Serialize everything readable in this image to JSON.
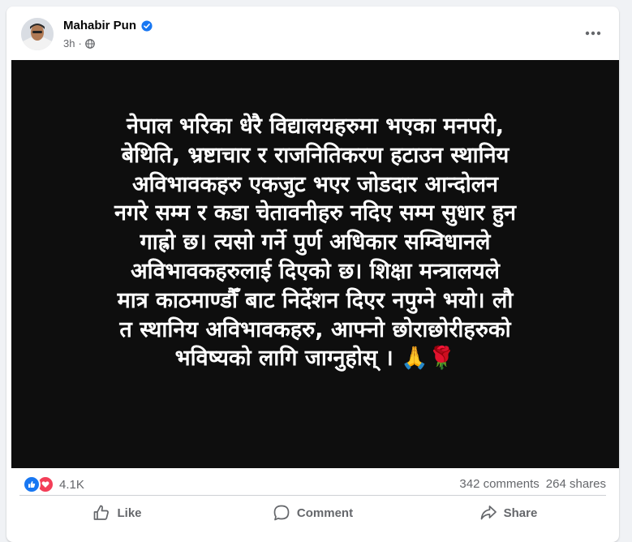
{
  "post": {
    "author": "Mahabir Pun",
    "time": "3h",
    "audience_icon": "globe-icon",
    "verified_icon": "verified-badge-icon",
    "more_icon": "more-options-icon"
  },
  "image_text": {
    "lines": [
      "नेपाल भरिका धेरै विद्यालयहरुमा भएका मनपरी,",
      "बेथिति, भ्रष्टाचार र राजनितिकरण हटाउन स्थानिय",
      "अविभावकहरु एकजुट भएर जोडदार आन्दोलन",
      "नगरे सम्म र कडा चेतावनीहरु नदिए सम्म सुधार हुन",
      "गाह्रो छ। त्यसो गर्ने पुर्ण अधिकार सम्विधानले",
      "अविभावकहरुलाई दिएको छ। शिक्षा मन्त्रालयले",
      "मात्र काठमाण्डौँ बाट निर्देशन दिएर नपुग्ने भयो। लौ",
      "त स्थानिय अविभावकहरु, आफ्नो छोराछोरीहरुको",
      "भविष्यको लागि जाग्नुहोस् । 🙏🌹"
    ]
  },
  "stats": {
    "reactions_count": "4.1K",
    "comments": "342 comments",
    "shares": "264 shares"
  },
  "actions": {
    "like": "Like",
    "comment": "Comment",
    "share": "Share"
  },
  "colors": {
    "accent": "#1877f2",
    "love": "#f33e58",
    "image_bg": "#0e0e0e",
    "muted_text": "#65676b"
  }
}
